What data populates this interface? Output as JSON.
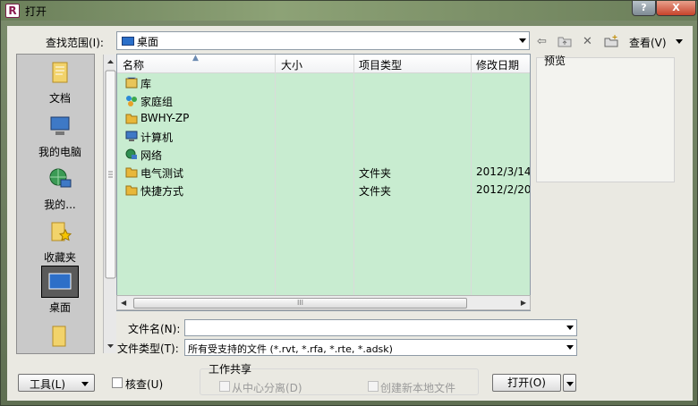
{
  "window": {
    "title": "打开",
    "help_label": "?",
    "close_label": "X"
  },
  "toolbar": {
    "lookin_label": "查找范围(I):",
    "lookin_value": "桌面",
    "view_label": "查看(V)"
  },
  "places": [
    {
      "label": "文档",
      "icon": "documents-icon"
    },
    {
      "label": "我的电脑",
      "icon": "computer-icon"
    },
    {
      "label": "我的...",
      "icon": "network-icon"
    },
    {
      "label": "收藏夹",
      "icon": "favorites-icon"
    },
    {
      "label": "桌面",
      "icon": "desktop-icon"
    }
  ],
  "columns": {
    "name": "名称",
    "size": "大小",
    "type": "项目类型",
    "modified": "修改日期"
  },
  "files": [
    {
      "name": "库",
      "type": "",
      "date": "",
      "icon": "library-icon"
    },
    {
      "name": "家庭组",
      "type": "",
      "date": "",
      "icon": "homegroup-icon"
    },
    {
      "name": "BWHY-ZP",
      "type": "",
      "date": "",
      "icon": "user-folder-icon"
    },
    {
      "name": "计算机",
      "type": "",
      "date": "",
      "icon": "computer-icon"
    },
    {
      "name": "网络",
      "type": "",
      "date": "",
      "icon": "network-icon"
    },
    {
      "name": "电气测试",
      "type": "文件夹",
      "date": "2012/3/14",
      "icon": "folder-icon"
    },
    {
      "name": "快捷方式",
      "type": "文件夹",
      "date": "2012/2/20",
      "icon": "folder-icon"
    }
  ],
  "scrollbar": {
    "thumb_grip": "III"
  },
  "preview_label": "预览",
  "filename_label": "文件名(N):",
  "filename_value": "",
  "filetype_label": "文件类型(T):",
  "filetype_value": "所有受支持的文件 (*.rvt, *.rfa, *.rte, *.adsk)",
  "tools_label": "工具(L)",
  "audit_label": "核查(U)",
  "worksharing": {
    "group_label": "工作共享",
    "detach_label": "从中心分离(D)",
    "newlocal_label": "创建新本地文件"
  },
  "open_label": "打开(O)",
  "colors": {
    "list_bg": "#c8ecd0",
    "folder": "#e8b73a"
  }
}
